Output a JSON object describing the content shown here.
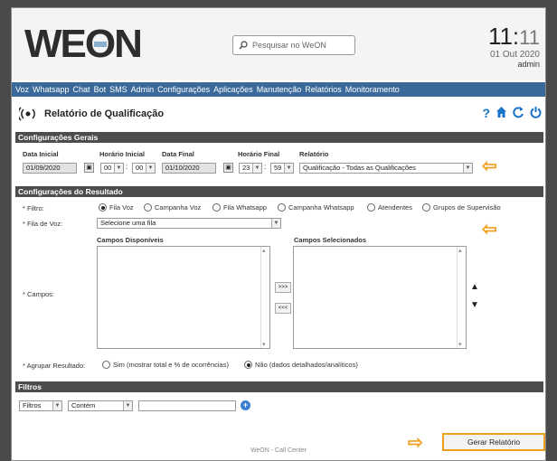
{
  "header": {
    "logo": "WE",
    "logo_o": "O",
    "logo_n": "N",
    "search_placeholder": "Pesquisar no WeON",
    "time_hm": "11:",
    "time_s": "11",
    "date": "01 Out 2020",
    "user": "admin"
  },
  "menu": [
    "Voz",
    "Whatsapp",
    "Chat",
    "Bot",
    "SMS",
    "Admin",
    "Configurações",
    "Aplicações",
    "Manutenção",
    "Relatórios",
    "Monitoramento"
  ],
  "page": {
    "title": "Relatório de Qualificação",
    "icons": [
      "help-icon",
      "home-icon",
      "refresh-icon",
      "power-icon"
    ]
  },
  "config_gerais": {
    "section_title": "Configurações Gerais",
    "data_inicial_label": "Data Inicial",
    "data_inicial": "01/09/2020",
    "horario_inicial_label": "Horário Inicial",
    "hi_h": "00",
    "hi_m": "00",
    "data_final_label": "Data Final",
    "data_final": "01/10/2020",
    "horario_final_label": "Horário Final",
    "hf_h": "23",
    "hf_m": "59",
    "relatorio_label": "Relatório",
    "relatorio_value": "Qualificação - Todas as Qualificações"
  },
  "config_resultado": {
    "section_title": "Configurações do Resultado",
    "filtro_label": "* Filtro:",
    "filtro_options": [
      "Fila Voz",
      "Campanha Voz",
      "Fila Whatsapp",
      "Campanha Whatsapp",
      "Atendentes",
      "Grupos de Supervisão"
    ],
    "filtro_selected": "Fila Voz",
    "fila_voz_label": "* Fila de Voz:",
    "fila_voz_value": "Selecione uma fila",
    "campos_label": "* Campos:",
    "campos_disponiveis": "Campos Disponíveis",
    "campos_selecionados": "Campos Selecionados",
    "move_right": ">>>",
    "move_left": "<<<",
    "agrupar_label": "* Agrupar Resultado:",
    "agrupar_sim": "Sim (mostrar total e % de ocorrências)",
    "agrupar_nao": "Não (dados detalhados/analíticos)",
    "agrupar_selected": "Não"
  },
  "filtros": {
    "section_title": "Filtros",
    "field_value": "Filtros",
    "operator_value": "Contém",
    "text_value": ""
  },
  "footer": {
    "brand": "WeON - Call Center",
    "generate_button": "Gerar Relatório"
  },
  "colors": {
    "menu_bg": "#3b6a9a",
    "section_bg": "#4d4d4d",
    "accent_orange": "#f0a020",
    "icon_blue": "#1a73c8"
  }
}
